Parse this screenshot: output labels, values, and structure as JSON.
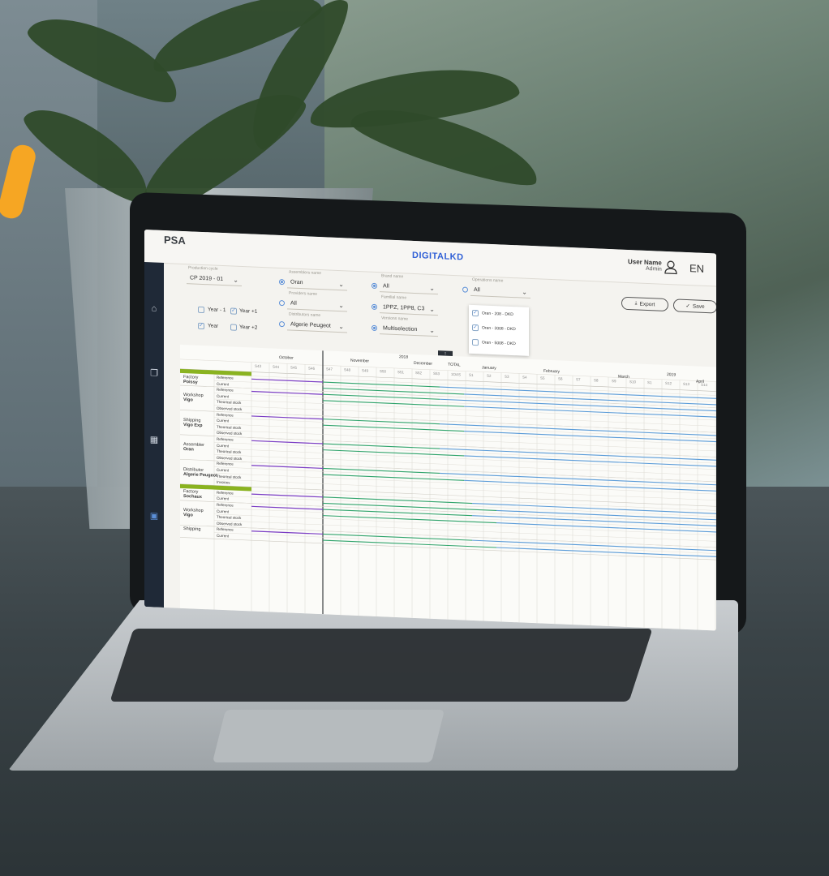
{
  "header": {
    "logo": "PSA",
    "brand": "DIGITALKD",
    "user_name": "User Name",
    "user_role": "Admin",
    "language": "EN"
  },
  "filters": {
    "production_cycle": {
      "label": "Production cycle",
      "value": "CP 2019 - 01"
    },
    "assembler": {
      "label": "Assemblers name",
      "value": "Oran"
    },
    "provider": {
      "label": "Providers name",
      "value": "All"
    },
    "distributor": {
      "label": "Distributors name",
      "value": "Algerie Peugeot"
    },
    "brand": {
      "label": "Brand name",
      "value": "All"
    },
    "family": {
      "label": "Familial name",
      "value": "1PPZ, 1PP8, C3"
    },
    "version": {
      "label": "Versions name",
      "value": "Multiselection"
    },
    "operations": {
      "label": "Operations name",
      "value": "All"
    },
    "years": [
      {
        "label": "Year - 1",
        "checked": false
      },
      {
        "label": "Year +1",
        "checked": true
      },
      {
        "label": "Year",
        "checked": true
      },
      {
        "label": "Year +2",
        "checked": false
      }
    ],
    "operations_options": [
      {
        "label": "Oran - 208 - DKD",
        "checked": true
      },
      {
        "label": "Oran - 3008 - DKD",
        "checked": true
      },
      {
        "label": "Oran - 5008 - DKD",
        "checked": false
      }
    ]
  },
  "actions": {
    "export": "Export",
    "save": "Save"
  },
  "calendar": {
    "years": [
      "2018",
      "2019"
    ],
    "months": [
      "October",
      "November",
      "December",
      "TOTAL",
      "January",
      "February",
      "March",
      "April"
    ],
    "weeks": [
      "S43",
      "S44",
      "S45",
      "S46",
      "S47",
      "S48",
      "S49",
      "S50",
      "S51",
      "S52",
      "S53",
      "1OAS",
      "S1",
      "S2",
      "S3",
      "S4",
      "S5",
      "S6",
      "S7",
      "S8",
      "S9",
      "S10",
      "S1",
      "S12",
      "S13",
      "S14"
    ]
  },
  "sections": [
    {
      "name": "Kind Peugeot",
      "groups": [
        {
          "prefix": "Factory",
          "name": "Poissy",
          "rows": [
            "Reference",
            "Current"
          ]
        },
        {
          "prefix": "Workshop",
          "name": "Vigo",
          "rows": [
            "Reference",
            "Current",
            "Theorical stock",
            "Observed stock"
          ]
        },
        {
          "prefix": "Shipping",
          "name": "Vigo Exp",
          "rows": [
            "Reference",
            "Current",
            "Theorical stock",
            "Observed stock"
          ]
        },
        {
          "prefix": "Assembler",
          "name": "Oran",
          "rows": [
            "Reference",
            "Current",
            "Theorical stock",
            "Observed stock"
          ]
        },
        {
          "prefix": "Distributor",
          "name": "Algerie Peugeot",
          "rows": [
            "Reference",
            "Current",
            "Theorical stock",
            "Invoices"
          ]
        }
      ]
    },
    {
      "name": "Kind Citroën",
      "groups": [
        {
          "prefix": "Factory",
          "name": "Sochaux",
          "rows": [
            "Reference",
            "Current"
          ]
        },
        {
          "prefix": "Workshop",
          "name": "Vigo",
          "rows": [
            "Reference",
            "Current",
            "Theorical stock",
            "Observed stock"
          ]
        },
        {
          "prefix": "Shipping",
          "name": "",
          "rows": [
            "Reference",
            "Current"
          ]
        }
      ]
    }
  ],
  "colors": {
    "reference": "#7a3cc4",
    "current_green": "#2fa36b",
    "current_blue": "#5a9bd8",
    "section": "#8ab320",
    "accent": "#2f5fd6"
  }
}
